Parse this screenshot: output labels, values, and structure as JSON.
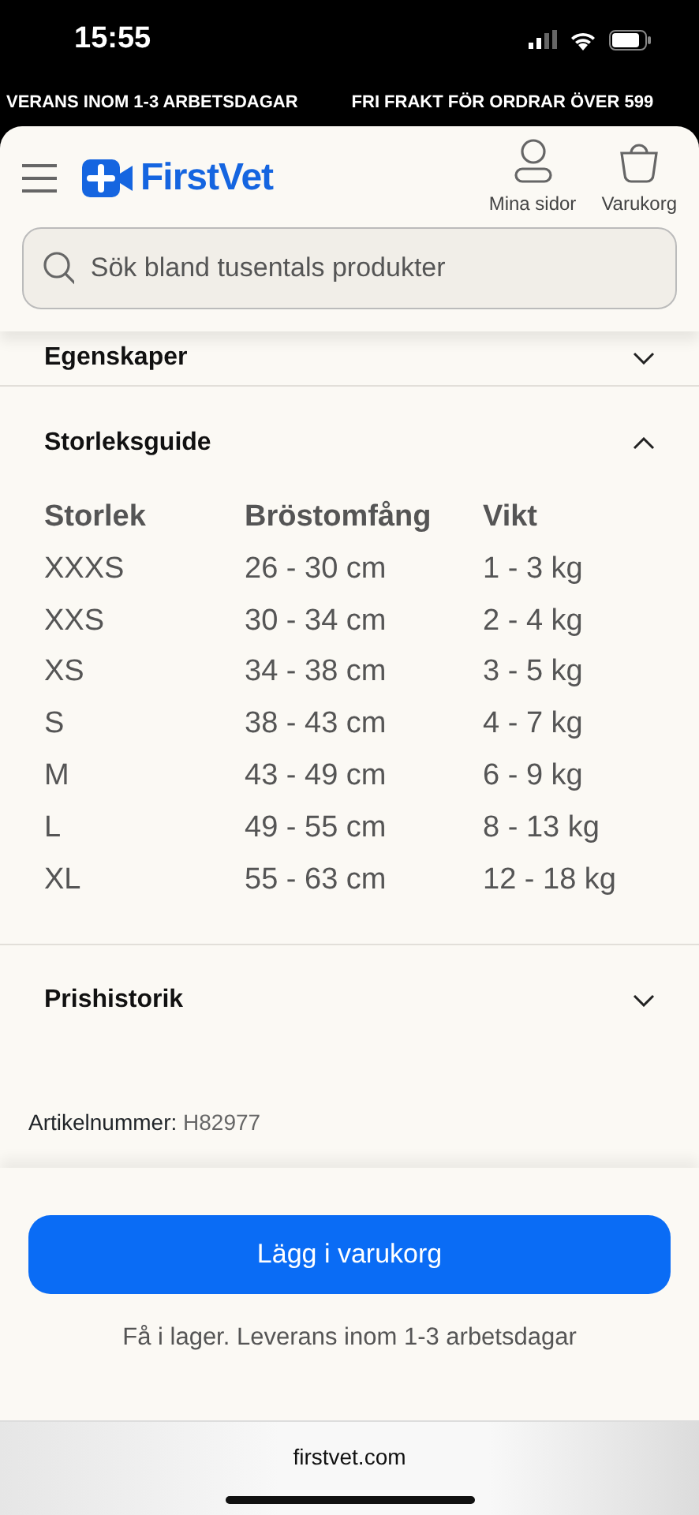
{
  "status_bar": {
    "time": "15:55"
  },
  "banner": [
    "VERANS INOM 1-3 ARBETSDAGAR",
    "FRI FRAKT FÖR ORDRAR ÖVER 599"
  ],
  "header": {
    "logo": "FirstVet",
    "actions": [
      {
        "label": "Mina sidor",
        "kind": "user"
      },
      {
        "label": "Varukorg",
        "kind": "bag"
      }
    ],
    "search": {
      "placeholder": "Sök bland tusentals produkter"
    }
  },
  "sections": [
    {
      "title": "Egenskaper",
      "expanded": false
    },
    {
      "title": "Storleksguide",
      "expanded": true,
      "table": {
        "columns": [
          "Storlek",
          "Bröstomfång",
          "Vikt"
        ],
        "rows": [
          [
            "XXXS",
            "26 - 30 cm",
            "1 - 3 kg"
          ],
          [
            "XXS",
            "30 - 34 cm",
            "2 - 4 kg"
          ],
          [
            "XS",
            "34 - 38 cm",
            "3 - 5 kg"
          ],
          [
            "S",
            "38 - 43 cm",
            "4 - 7 kg"
          ],
          [
            "M",
            "43 - 49 cm",
            "6 - 9 kg"
          ],
          [
            "L",
            "49 - 55 cm",
            "8 - 13 kg"
          ],
          [
            "XL",
            "55 - 63 cm",
            "12 - 18 kg"
          ]
        ]
      }
    },
    {
      "title": "Prishistorik",
      "expanded": false
    }
  ],
  "article": {
    "label": "Artikelnummer:",
    "value": "H82977"
  },
  "buy": {
    "button": "Lägg i varukorg",
    "stock": "Få i lager. Leverans inom 1-3 arbetsdagar"
  },
  "browser": {
    "url": "firstvet.com"
  }
}
